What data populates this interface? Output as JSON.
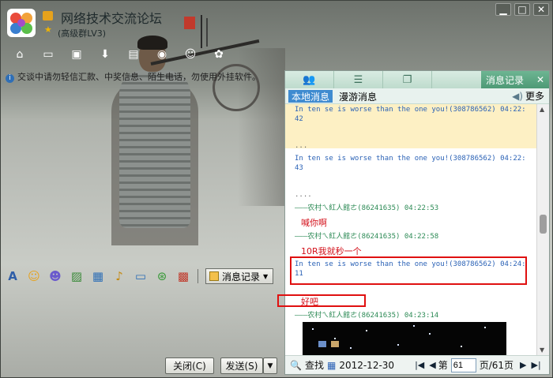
{
  "window": {
    "title": "网络技术交流论坛",
    "group_level": "(高级群LV3)",
    "controls": [
      "minimize",
      "maximize",
      "close"
    ]
  },
  "notice": "交谈中请勿轻信汇款、中奖信息、陌生电话，勿使用外挂软件。",
  "toolbar_icons": [
    "home-icon",
    "folder-icon",
    "note-icon",
    "download-icon",
    "doc-icon",
    "camera-icon",
    "person-icon",
    "settings-icon"
  ],
  "input_toolbar": {
    "history_label": "消息记录"
  },
  "buttons": {
    "close": "关闭(C)",
    "send": "发送(S)"
  },
  "panel": {
    "active_tab": "消息记录",
    "subtab_local": "本地消息",
    "subtab_roam": "漫游消息",
    "more": "更多",
    "messages": [
      {
        "line1": "In ten se is worse than the one you!(308786562)  04:22:",
        "line2": "42"
      },
      {
        "dots": "..."
      },
      {
        "line1": "In ten se is worse than the one you!(308786562)  04:22:",
        "line2": "43"
      },
      {
        "dots": "...."
      },
      {
        "sender": "———农村ㄟ紅人館ㄜ(86241635)  04:22:53",
        "text": "喊你啊"
      },
      {
        "sender": "———农村ㄟ紅人館ㄜ(86241635)  04:22:58",
        "text": "10R我就秒一个"
      },
      {
        "line1": "In ten se is worse than the one you!(308786562)  04:24:",
        "line2": "11"
      },
      {
        "text": "好吧"
      },
      {
        "sender": "———农村ㄟ紅人館ㄜ(86241635)  04:23:14"
      }
    ],
    "pager": {
      "find": "查找",
      "date": "2012-12-30",
      "page_prefix": "第",
      "page_value": "61",
      "page_suffix": "页/61页"
    }
  },
  "colors": {
    "panel_tab_active": "#4e9a76",
    "highlight_red": "#e01010",
    "sender_green": "#2c8a55",
    "message_blue": "#2b62b6"
  }
}
